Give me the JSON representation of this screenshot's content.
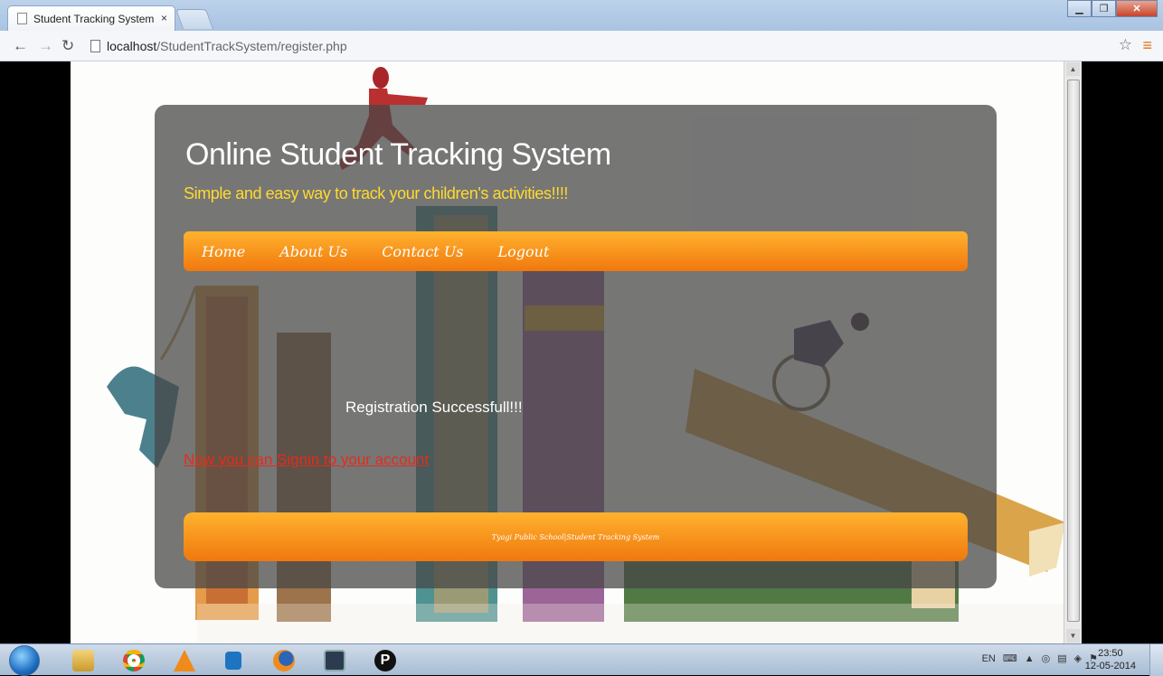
{
  "browser": {
    "tab_title": "Student Tracking System",
    "tab_close": "×",
    "url_host": "localhost",
    "url_path": "/StudentTrackSystem/register.php"
  },
  "site": {
    "title": "Online Student Tracking System",
    "tagline": "Simple and easy way to track your children's activities!!!!",
    "nav": [
      "Home",
      "About Us",
      "Contact Us",
      "Logout"
    ],
    "message": "Registration Successfull!!!",
    "signin_link": "Now you can Signin to your account",
    "footer": "Tyagi Public School|Student Tracking System"
  },
  "taskbar": {
    "lang": "EN",
    "time": "23:50",
    "date": "12-05-2014"
  },
  "colors": {
    "accent_orange": "#f0780e",
    "tagline_yellow": "#ffda2e",
    "link_red": "#e52b1c"
  }
}
